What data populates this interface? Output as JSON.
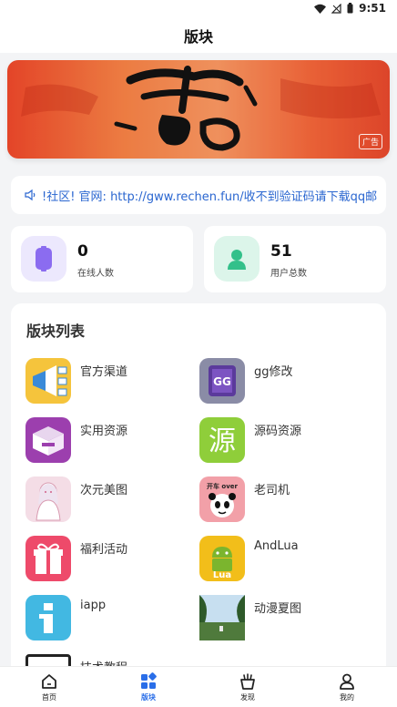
{
  "status_bar": {
    "time": "9:51"
  },
  "header": {
    "title": "版块"
  },
  "banner": {
    "ad_label": "广告"
  },
  "notice": {
    "text": "!社区! 官网: http://gww.rechen.fun/收不到验证码请下载qq邮"
  },
  "stats": [
    {
      "value": "0",
      "label": "在线人数",
      "color": "#8b6cf0"
    },
    {
      "value": "51",
      "label": "用户总数",
      "color": "#33c08a"
    }
  ],
  "section": {
    "title": "版块列表",
    "items": [
      {
        "label": "官方渠道",
        "icon": "megaphone-icon"
      },
      {
        "label": "gg修改",
        "icon": "gg-icon"
      },
      {
        "label": "实用资源",
        "icon": "box-icon"
      },
      {
        "label": "源码资源",
        "icon": "source-icon"
      },
      {
        "label": "次元美图",
        "icon": "anime-girl-icon"
      },
      {
        "label": "老司机",
        "icon": "panda-icon"
      },
      {
        "label": "福利活动",
        "icon": "gift-icon"
      },
      {
        "label": "AndLua",
        "icon": "android-icon"
      },
      {
        "label": "iapp",
        "icon": "iapp-icon"
      },
      {
        "label": "动漫夏图",
        "icon": "landscape-icon"
      },
      {
        "label": "技术教程",
        "icon": "tutorial-icon"
      }
    ],
    "source_glyph": "源",
    "panda_text": "开车 over",
    "lua_text": "Lua",
    "gg_text": "GG"
  },
  "bottom_nav": [
    {
      "label": "首页",
      "active": false
    },
    {
      "label": "版块",
      "active": true
    },
    {
      "label": "发现",
      "active": false
    },
    {
      "label": "我的",
      "active": false
    }
  ],
  "colors": {
    "accent": "#2a6ee8",
    "notice_text": "#2a66d0"
  }
}
